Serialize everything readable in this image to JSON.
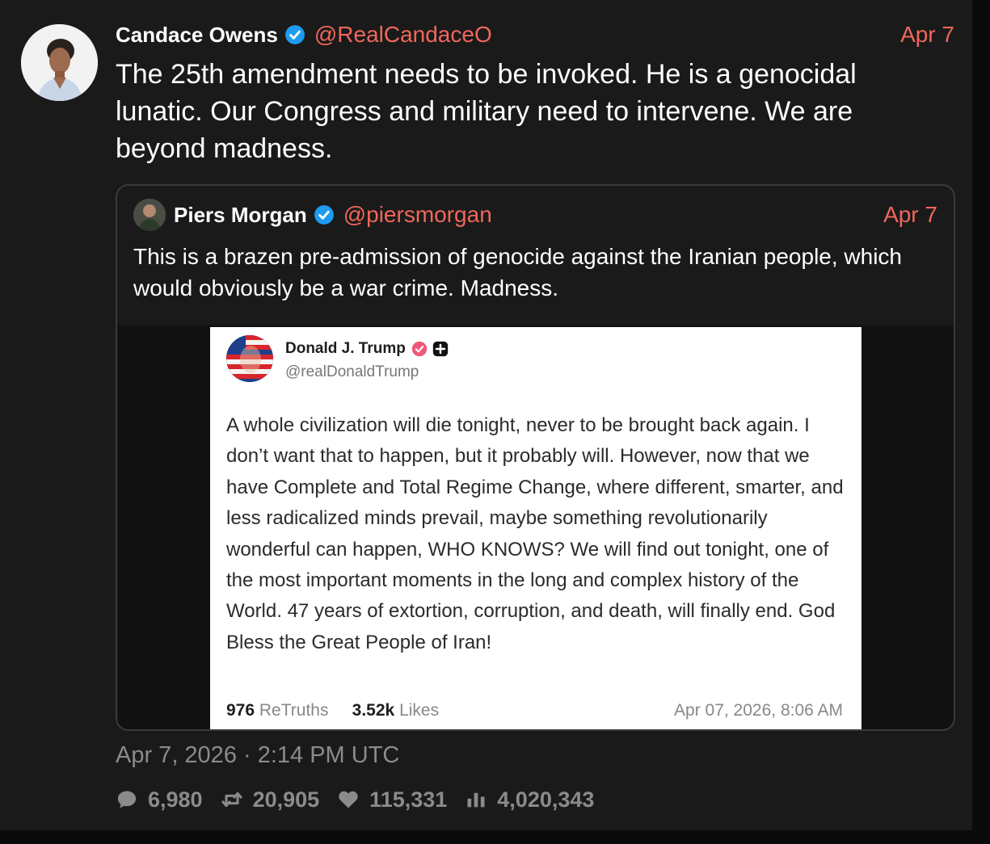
{
  "post": {
    "author": "Candace Owens",
    "handle": "@RealCandaceO",
    "date": "Apr 7",
    "text": "The 25th amendment needs to be invoked.  He is a genocidal lunatic. Our Congress and military need to intervene. We are beyond madness."
  },
  "quote": {
    "author": "Piers Morgan",
    "handle": "@piersmorgan",
    "date": "Apr 7",
    "text": "This is a brazen pre-admission of genocide against the Iranian people, which would obviously be a war crime. Madness."
  },
  "embedded": {
    "author": "Donald J. Trump",
    "handle": "@realDonaldTrump",
    "text": "A whole civilization will die tonight, never to be brought back again. I don’t want that to happen, but it probably will. However, now that we have Complete and Total Regime Change, where different, smarter, and less radicalized minds prevail, maybe something revolutionarily wonderful can happen, WHO KNOWS? We will find out tonight, one of the most important moments in the long and complex history of the World. 47 years of extortion, corruption, and death, will finally end. God Bless the Great People of Iran!",
    "retruths_count": "976",
    "retruths_label": "ReTruths",
    "likes_count": "3.52k",
    "likes_label": "Likes",
    "timestamp": "Apr 07, 2026, 8:06 AM"
  },
  "meta": {
    "timestamp": "Apr 7, 2026 · 2:14 PM UTC"
  },
  "stats": {
    "replies": "6,980",
    "retweets": "20,905",
    "likes": "115,331",
    "views": "4,020,343"
  },
  "icons": {
    "verified": "verified-badge-icon",
    "reply": "comment-icon",
    "retweet": "retweet-icon",
    "like": "heart-icon",
    "views": "bar-chart-icon"
  },
  "colors": {
    "accent": "#f0675a",
    "verified": "#1d9bf0",
    "truth_verified": "#f0577a",
    "muted": "#8b8b8b"
  }
}
